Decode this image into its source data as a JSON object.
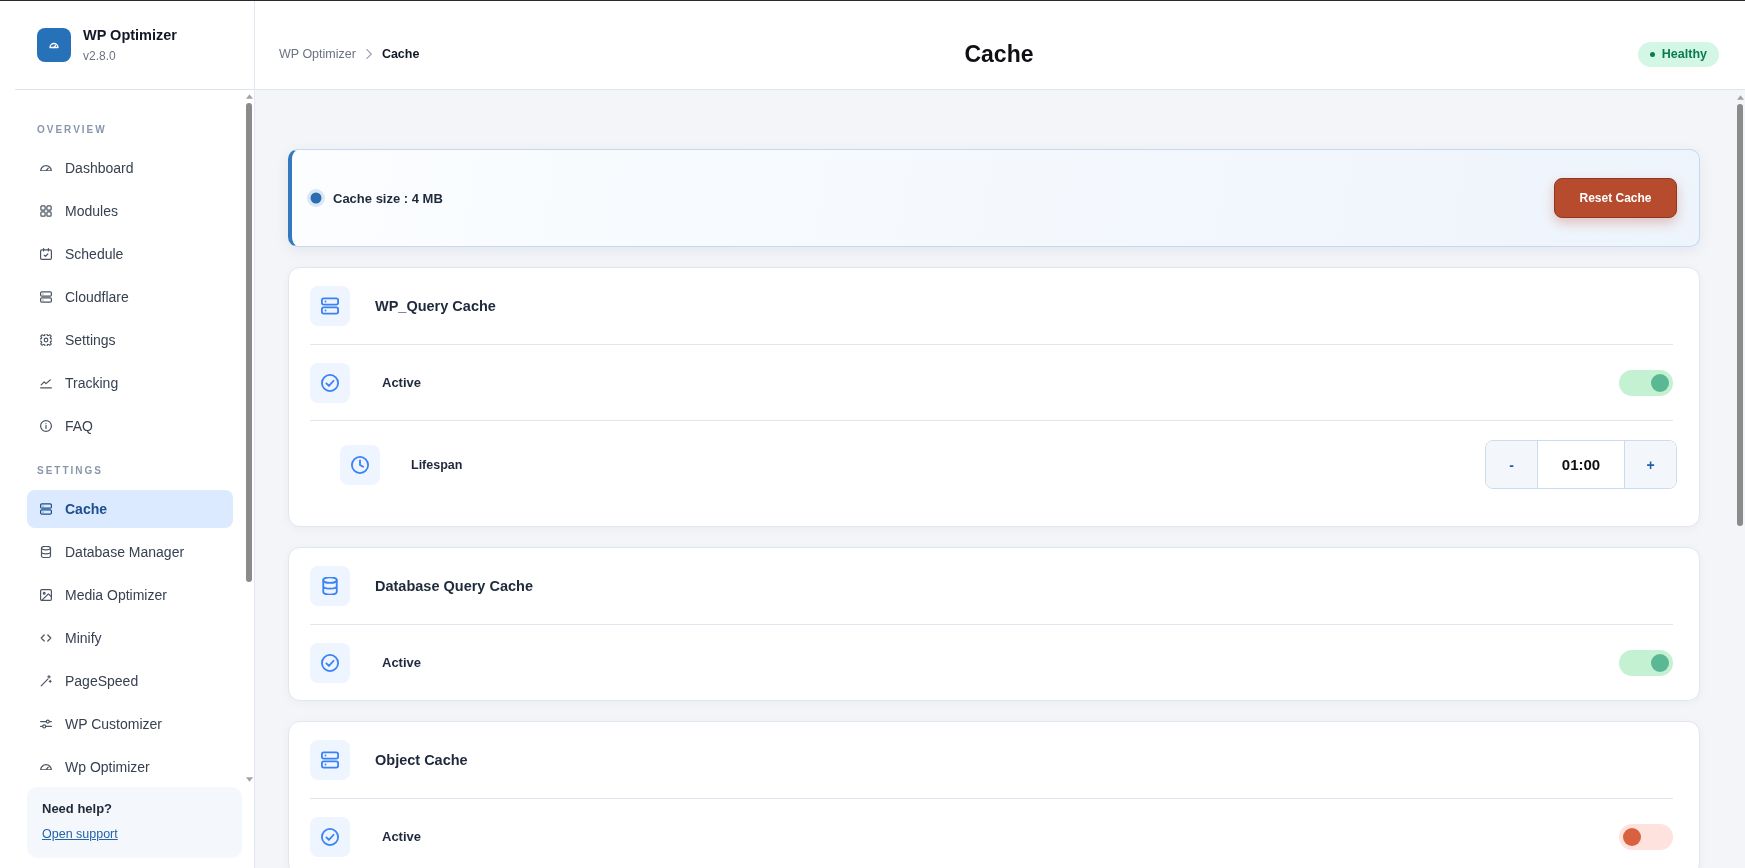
{
  "sidebar": {
    "brand": {
      "name": "WP Optimizer",
      "version": "v2.8.0"
    },
    "sections": [
      {
        "heading": "OVERVIEW",
        "items": [
          {
            "label": "Dashboard",
            "selected": false
          },
          {
            "label": "Modules",
            "selected": false
          },
          {
            "label": "Schedule",
            "selected": false
          },
          {
            "label": "Cloudflare",
            "selected": false
          },
          {
            "label": "Settings",
            "selected": false
          },
          {
            "label": "Tracking",
            "selected": false
          },
          {
            "label": "FAQ",
            "selected": false
          }
        ]
      },
      {
        "heading": "SETTINGS",
        "items": [
          {
            "label": "Cache",
            "selected": true
          },
          {
            "label": "Database Manager",
            "selected": false
          },
          {
            "label": "Media Optimizer",
            "selected": false
          },
          {
            "label": "Minify",
            "selected": false
          },
          {
            "label": "PageSpeed",
            "selected": false
          },
          {
            "label": "WP Customizer",
            "selected": false
          },
          {
            "label": "Wp Optimizer",
            "selected": false
          }
        ]
      }
    ],
    "help": {
      "title": "Need help?",
      "link": "Open support"
    }
  },
  "header": {
    "breadcrumb": [
      {
        "label": "WP Optimizer",
        "current": false
      },
      {
        "label": "Cache",
        "current": true
      }
    ],
    "title": "Cache",
    "status": "Healthy"
  },
  "cache_summary": {
    "label": "Cache size : 4 MB",
    "button": "Reset Cache"
  },
  "sections": [
    {
      "title": "WP_Query Cache",
      "settings": [
        {
          "kind": "toggle",
          "label": "Active",
          "on": true
        },
        {
          "kind": "stepper",
          "label": "Lifespan",
          "decrement": "-",
          "value": "01:00",
          "increment": "+"
        }
      ]
    },
    {
      "title": "Database Query Cache",
      "settings": [
        {
          "kind": "toggle",
          "label": "Active",
          "on": true
        }
      ]
    },
    {
      "title": "Object Cache",
      "settings": [
        {
          "kind": "toggle",
          "label": "Active",
          "on": false
        }
      ]
    }
  ]
}
